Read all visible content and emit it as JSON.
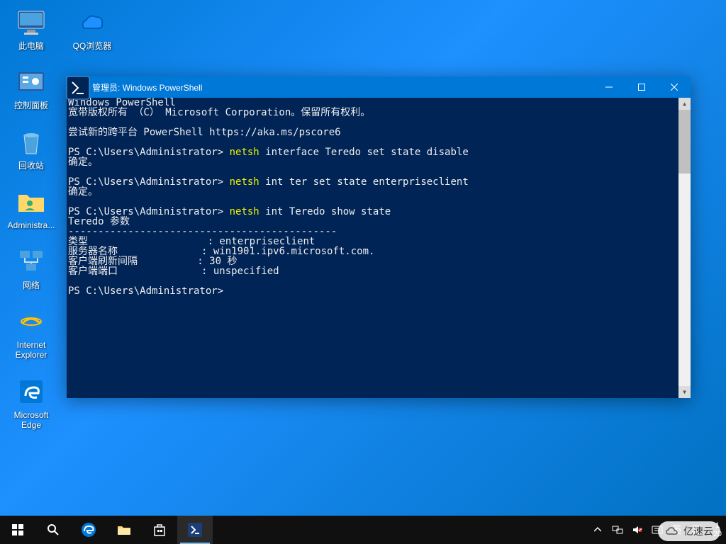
{
  "desktop": {
    "col1": [
      {
        "name": "pc",
        "label": "此电脑"
      },
      {
        "name": "control-panel",
        "label": "控制面板"
      },
      {
        "name": "recycle",
        "label": "回收站"
      },
      {
        "name": "admin",
        "label": "Administra..."
      },
      {
        "name": "network",
        "label": "网络"
      },
      {
        "name": "ie",
        "label": "Internet Explorer"
      },
      {
        "name": "edge",
        "label": "Microsoft Edge"
      }
    ],
    "col2": [
      {
        "name": "qq-browser",
        "label": "QQ浏览器"
      }
    ]
  },
  "window": {
    "title": "管理员: Windows PowerShell",
    "header1": "Windows PowerShell",
    "header2": "宽带版权所有 （C） Microsoft Corporation。保留所有权利。",
    "tip": "尝试新的跨平台 PowerShell https://aka.ms/pscore6",
    "prompt": "PS C:\\Users\\Administrator>",
    "cmd1_kw": "netsh",
    "cmd1_rest": " interface Teredo set state disable",
    "ok": "确定。",
    "cmd2_kw": "netsh",
    "cmd2_rest": " int ter set state enterpriseclient",
    "cmd3_kw": "netsh",
    "cmd3_rest": " int Teredo show state",
    "teredo_header": "Teredo 参数",
    "teredo_rule": "---------------------------------------------",
    "row1_k": "类型",
    "row1_v": ": enterpriseclient",
    "row2_k": "服务器名称",
    "row2_v": ": win1901.ipv6.microsoft.com.",
    "row3_k": "客户端刷新间隔",
    "row3_v": ": 30 秒",
    "row4_k": "客户端端口",
    "row4_v": ": unspecified"
  },
  "taskbar": {
    "ime1": "英",
    "ime2": "羿",
    "time": "1",
    "date": "20"
  },
  "watermark": "亿速云"
}
